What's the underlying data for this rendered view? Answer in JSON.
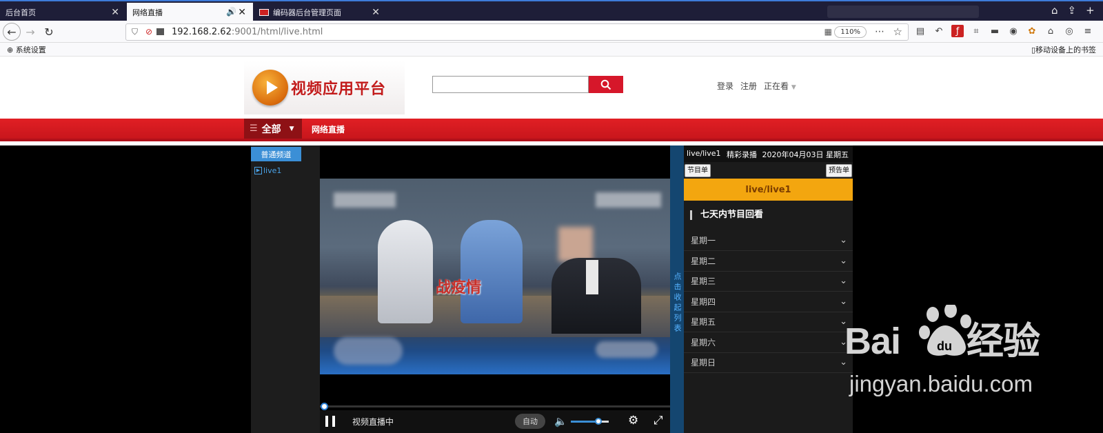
{
  "browser": {
    "tabs": [
      {
        "label": "后台首页",
        "active": false
      },
      {
        "label": "网络直播",
        "active": true,
        "audio": true
      },
      {
        "label": "编码器后台管理页面",
        "active": false
      }
    ],
    "url_host": "192.168.2.62",
    "url_rest": ":9001/html/live.html",
    "zoom": "110%",
    "bookmark_left": "系统设置",
    "bookmark_right": "移动设备上的书签"
  },
  "header": {
    "logo_text": "视频应用平台",
    "search_placeholder": "",
    "login": "登录",
    "register": "注册",
    "watching": "正在看"
  },
  "nav": {
    "all_label": "全部",
    "live_label": "网络直播"
  },
  "channels": {
    "tab": "普通频道",
    "items": [
      "live1"
    ]
  },
  "player": {
    "overlay_text": "战疫情",
    "status": "视频直播中",
    "quality": "自动",
    "progress": 0,
    "volume": 0.75
  },
  "collapse_label": "点击收起列表",
  "schedule": {
    "channel": "live/live1",
    "program": "精彩录播",
    "date": "2020年04月03日 星期五",
    "btn_program_list": "节目单",
    "btn_preview_list": "预告单",
    "current": "live/live1",
    "replay_title": "七天内节目回看",
    "days": [
      "星期一",
      "星期二",
      "星期三",
      "星期四",
      "星期五",
      "星期六",
      "星期日"
    ]
  },
  "watermark": {
    "line1_a": "Bai",
    "line1_b": "经验",
    "line2": "jingyan.baidu.com"
  }
}
